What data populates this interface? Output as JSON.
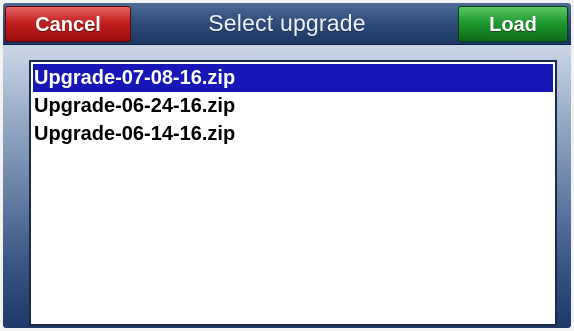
{
  "dialog": {
    "title": "Select upgrade",
    "cancel_label": "Cancel",
    "load_label": "Load"
  },
  "file_list": {
    "selected_index": 0,
    "items": [
      {
        "label": "Upgrade-07-08-16.zip",
        "selected": true
      },
      {
        "label": "Upgrade-06-24-16.zip",
        "selected": false
      },
      {
        "label": "Upgrade-06-14-16.zip",
        "selected": false
      }
    ]
  },
  "colors": {
    "cancel_button": "#c52121",
    "load_button": "#1f9a2e",
    "titlebar": "#2f4c7a",
    "selection_highlight": "#1717b8",
    "list_background": "#ffffff"
  }
}
